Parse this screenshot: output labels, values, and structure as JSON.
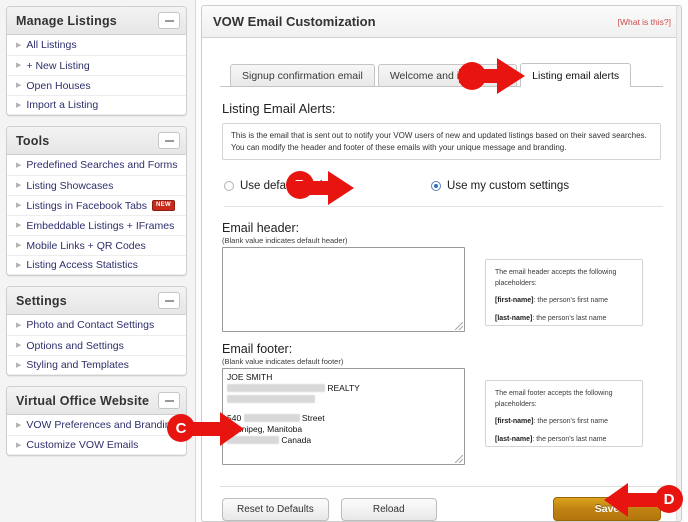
{
  "sidebar": {
    "panels": [
      {
        "title": "Manage Listings",
        "collapse_icon": "minus-icon",
        "items": [
          {
            "label": "All Listings"
          },
          {
            "label": "+ New Listing"
          },
          {
            "label": "Open Houses"
          },
          {
            "label": "Import a Listing"
          }
        ]
      },
      {
        "title": "Tools",
        "collapse_icon": "minus-icon",
        "items": [
          {
            "label": "Predefined Searches and Forms"
          },
          {
            "label": "Listing Showcases"
          },
          {
            "label": "Listings in Facebook Tabs",
            "badge": "NEW"
          },
          {
            "label": "Embeddable Listings + IFrames"
          },
          {
            "label": "Mobile Links + QR Codes"
          },
          {
            "label": "Listing Access Statistics"
          }
        ]
      },
      {
        "title": "Settings",
        "collapse_icon": "minus-icon",
        "items": [
          {
            "label": "Photo and Contact Settings"
          },
          {
            "label": "Options and Settings"
          },
          {
            "label": "Styling and Templates"
          }
        ]
      },
      {
        "title": "Virtual Office Website",
        "collapse_icon": "minus-icon",
        "items": [
          {
            "label": "VOW Preferences and Branding"
          },
          {
            "label": "Customize VOW Emails"
          }
        ]
      }
    ]
  },
  "main": {
    "title": "VOW Email Customization",
    "help_link": "[What is this?]",
    "tabs": [
      {
        "label": "Signup confirmation email",
        "active": false
      },
      {
        "label": "Welcome and intro email",
        "active": false
      },
      {
        "label": "Listing email alerts",
        "active": true
      }
    ],
    "section_title": "Listing Email Alerts:",
    "description": "This is the email that is sent out to notify your VOW users of new and updated listings based on their saved searches. You can modify the header and footer of these emails with your unique message and branding.",
    "radio_options": [
      {
        "label": "Use default settings",
        "selected": false
      },
      {
        "label": "Use my custom settings",
        "selected": true
      }
    ],
    "header_field": {
      "label": "Email header:",
      "hint": "(Blank value indicates default header)",
      "value": ""
    },
    "footer_field": {
      "label": "Email footer:",
      "hint": "(Blank value indicates default footer)",
      "lines": [
        "JOE SMITH",
        "REALTY",
        "540 Street",
        "Winnipeg, Manitoba",
        "Canada"
      ]
    },
    "header_placeholders": {
      "intro": "The email header accepts the following placeholders:",
      "first_name_key": "[first-name]",
      "first_name_desc": ": the person's first name",
      "last_name_key": "[last-name]",
      "last_name_desc": ": the person's last name"
    },
    "footer_placeholders": {
      "intro": "The email footer accepts the following placeholders:",
      "first_name_key": "[first-name]",
      "first_name_desc": ": the person's first name",
      "last_name_key": "[last-name]",
      "last_name_desc": ": the person's last name"
    },
    "buttons": {
      "reset": "Reset to Defaults",
      "reload": "Reload",
      "save": "Save"
    }
  },
  "annotations": {
    "color": "#e8140f",
    "markers": [
      {
        "id": "A",
        "points_to": "tab-listing-email-alerts"
      },
      {
        "id": "B",
        "points_to": "radio-use-my-custom-settings"
      },
      {
        "id": "C",
        "points_to": "email-footer-textarea"
      },
      {
        "id": "D",
        "points_to": "save-button"
      }
    ]
  }
}
